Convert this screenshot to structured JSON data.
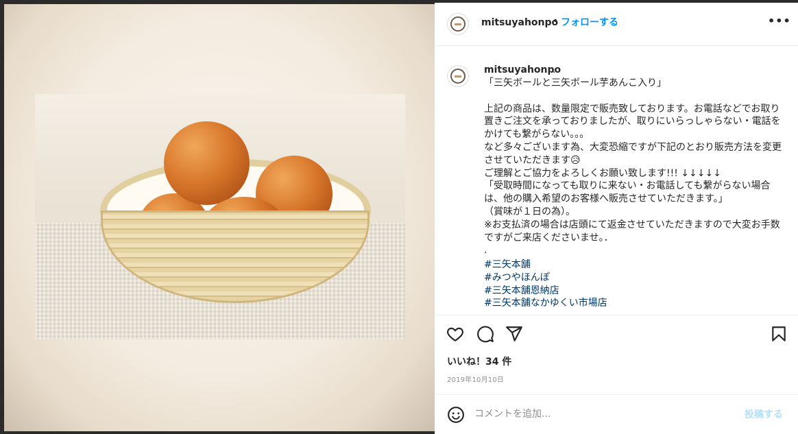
{
  "post": {
    "header": {
      "username": "mitsuyahonpo",
      "separator": "•",
      "follow_label": "フォローする",
      "more_label": "•••"
    },
    "caption": {
      "username": "mitsuyahonpo",
      "dot": ".",
      "text": "「三矢ボールと三矢ボール芋あんこ入り」\n\n上記の商品は、数量限定で販売致しております。お電話などでお取り置きご注文を承っておりましたが、取りにいらっしゃらない・電話をかけても繋がらない。。。\nなど多々ございます為、大変恐縮ですが下記のとおり販売方法を変更させていただきます😥\nご理解とご協力をよろしくお願い致します!!! ↓↓↓↓↓\n「受取時間になっても取りに来ない・お電話しても繋がらない場合は、他の購入希望のお客様へ販売させていただきます。」\n（賞味が１日の為）。\n※お支払済の場合は店頭にて返金させていただきますので大変お手数ですがご来店くださいませ。．\n.",
      "hashtags": [
        "#三矢本舗",
        "#みつやほんぽ",
        "#三矢本舗恩納店",
        "#三矢本舗なかゆくい市場店"
      ]
    },
    "actions": {
      "like_icon": "heart-icon",
      "comment_icon": "comment-bubble-icon",
      "share_icon": "paper-plane-icon",
      "save_icon": "bookmark-icon"
    },
    "likes_text": "いいね！34 件",
    "date": "2019年10月10日",
    "comment": {
      "placeholder": "コメントを追加...",
      "post_label": "投稿する"
    }
  },
  "colors": {
    "link": "#0095f6",
    "hashtag": "#00376b",
    "post_disabled": "#b2dffc",
    "muted": "#8e8e8e"
  }
}
